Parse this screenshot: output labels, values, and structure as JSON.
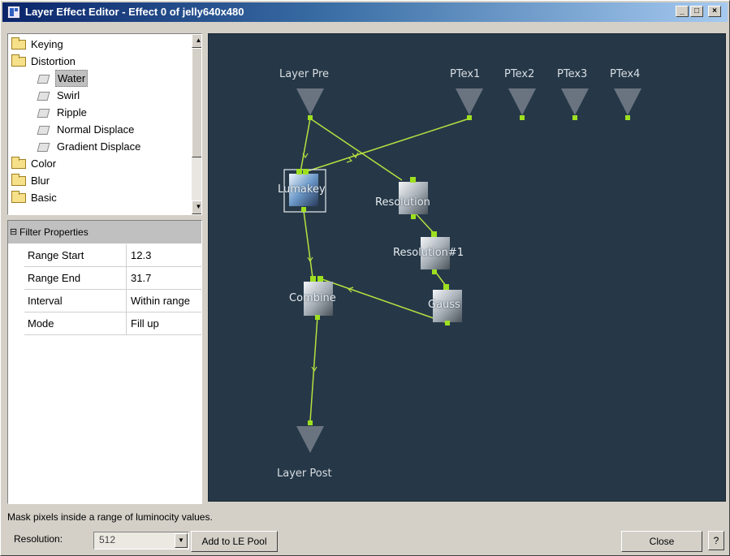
{
  "window": {
    "title": "Layer Effect Editor - Effect 0 of jelly640x480",
    "minimize_glyph": "_",
    "maximize_glyph": "□",
    "close_glyph": "×"
  },
  "tree": {
    "items": [
      {
        "label": "Keying",
        "type": "folder"
      },
      {
        "label": "Distortion",
        "type": "folder"
      },
      {
        "label": "Water",
        "type": "filter",
        "selected": true
      },
      {
        "label": "Swirl",
        "type": "filter"
      },
      {
        "label": "Ripple",
        "type": "filter"
      },
      {
        "label": "Normal Displace",
        "type": "filter"
      },
      {
        "label": "Gradient Displace",
        "type": "filter"
      },
      {
        "label": "Color",
        "type": "folder"
      },
      {
        "label": "Blur",
        "type": "folder"
      },
      {
        "label": "Basic",
        "type": "folder"
      }
    ],
    "scroll_up": "▲",
    "scroll_down": "▼"
  },
  "properties": {
    "header": "Filter Properties",
    "collapse_glyph": "⊟",
    "rows": [
      {
        "name": "Range Start",
        "value": "12.3"
      },
      {
        "name": "Range End",
        "value": "31.7"
      },
      {
        "name": "Interval",
        "value": "Within range"
      },
      {
        "name": "Mode",
        "value": "Fill up"
      }
    ]
  },
  "graph": {
    "inputs": {
      "layer_pre": "Layer Pre",
      "ptex1": "PTex1",
      "ptex2": "PTex2",
      "ptex3": "PTex3",
      "ptex4": "PTex4"
    },
    "output": "Layer Post",
    "nodes": {
      "lumakey": "Lumakey",
      "resolution": "Resolution",
      "resolution1": "Resolution#1",
      "gauss": "Gauss",
      "combine": "Combine"
    },
    "colors": {
      "background": "#263848",
      "wire": "#b8e040",
      "port": "#9ee020",
      "triangle": "#6a7480"
    }
  },
  "status": {
    "text": "Mask pixels inside a range of luminocity values."
  },
  "bottom": {
    "resolution_label": "Resolution:",
    "resolution_value": "512",
    "dropdown_glyph": "▼",
    "add_button": "Add to LE Pool",
    "close_button": "Close",
    "help_button": "?"
  }
}
